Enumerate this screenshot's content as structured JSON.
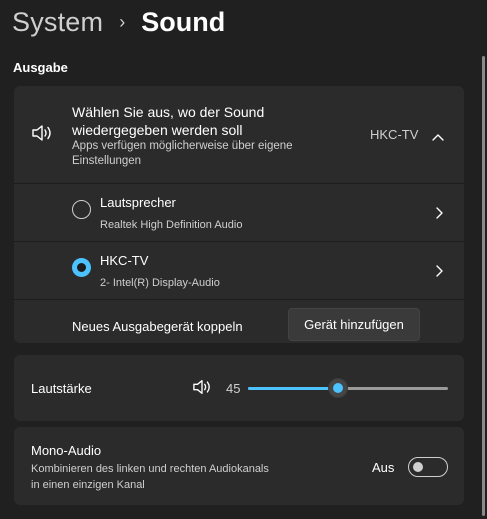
{
  "breadcrumb": {
    "parent": "System",
    "separator": "›",
    "current": "Sound"
  },
  "section": {
    "title": "Ausgabe"
  },
  "output": {
    "title": "Wählen Sie aus, wo der Sound wiedergegeben werden soll",
    "subtitle": "Apps verfügen möglicherweise über eigene Einstellungen",
    "selected_device": "HKC-TV",
    "devices": [
      {
        "name": "Lautsprecher",
        "description": "Realtek High Definition Audio",
        "selected": false
      },
      {
        "name": "HKC-TV",
        "description": "2- Intel(R) Display-Audio",
        "selected": true
      }
    ],
    "pair_label": "Neues Ausgabegerät koppeln",
    "add_button_label": "Gerät hinzufügen"
  },
  "volume": {
    "label": "Lautstärke",
    "value": "45",
    "level_percent": 45
  },
  "mono": {
    "title": "Mono-Audio",
    "description": "Kombinieren des linken und rechten Audiokanals in einen einzigen Kanal",
    "state_label": "Aus",
    "enabled": false
  },
  "colors": {
    "accent": "#4cc2ff",
    "background": "#202020",
    "card": "#2b2b2b"
  },
  "icons": {
    "speaker": "speaker-icon",
    "chevron_up": "chevron-up-icon",
    "chevron_right": "chevron-right-icon"
  }
}
